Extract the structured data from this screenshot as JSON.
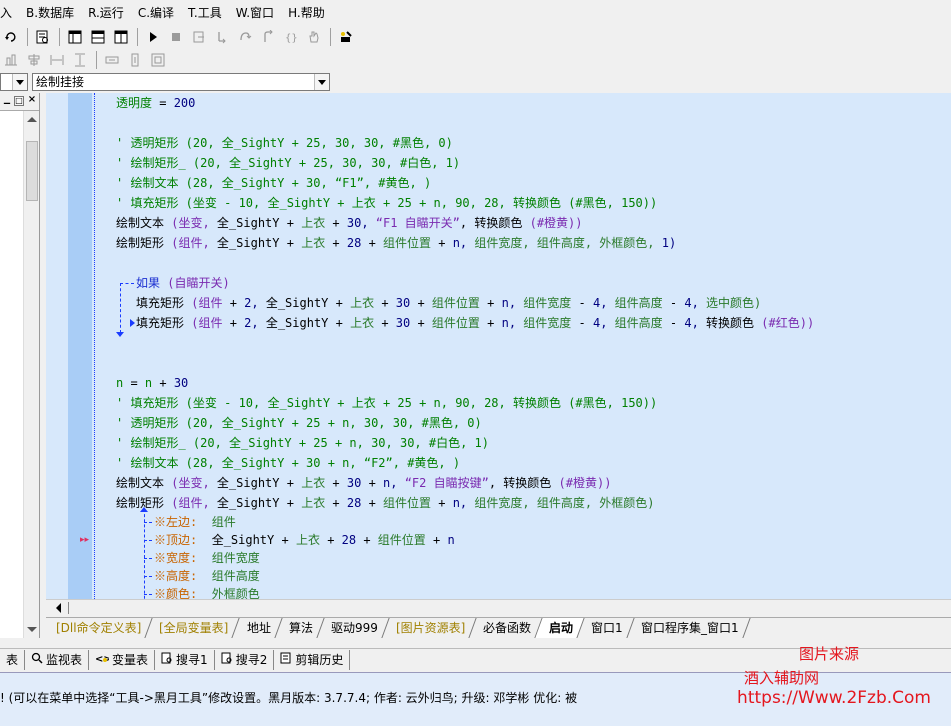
{
  "menu": [
    "入",
    "B.数据库",
    "R.运行",
    "C.编译",
    "T.工具",
    "W.窗口",
    "H.帮助"
  ],
  "combo_left": "",
  "combo_right": "绘制挂接",
  "code_lines": [
    {
      "indent": 0,
      "parts": [
        [
          "c",
          "透明度 "
        ],
        [
          "k",
          "= "
        ],
        [
          "n",
          "200"
        ]
      ]
    },
    {
      "indent": 0,
      "parts": []
    },
    {
      "indent": 0,
      "parts": [
        [
          "c",
          "' 透明矩形 (20, 全_SightY + 25, 30, 30, #黑色, 0)"
        ]
      ]
    },
    {
      "indent": 0,
      "parts": [
        [
          "c",
          "' 绘制矩形_ (20, 全_SightY + 25, 30, 30, #白色, 1)"
        ]
      ]
    },
    {
      "indent": 0,
      "parts": [
        [
          "c",
          "' 绘制文本 (28, 全_SightY + 30, “F1”, #黄色, )"
        ]
      ]
    },
    {
      "indent": 0,
      "parts": [
        [
          "c",
          "' 填充矩形 (坐变 - 10, 全_SightY + 上衣 + 25 + n, 90, 28, 转换颜色 (#黑色, 150))"
        ]
      ]
    },
    {
      "indent": 0,
      "parts": [
        [
          "k",
          "绘制文本 "
        ],
        [
          "p",
          "(坐变, "
        ],
        [
          "k",
          "全_SightY "
        ],
        [
          "k",
          "+ "
        ],
        [
          "s",
          "上衣 "
        ],
        [
          "k",
          "+ "
        ],
        [
          "n",
          "30, "
        ],
        [
          "p",
          "“F1 自瞄开关”"
        ],
        [
          "k",
          ", 转换颜色 "
        ],
        [
          "p",
          "(#橙黄))"
        ]
      ]
    },
    {
      "indent": 0,
      "parts": [
        [
          "k",
          "绘制矩形 "
        ],
        [
          "p",
          "(组件, "
        ],
        [
          "k",
          "全_SightY "
        ],
        [
          "k",
          "+ "
        ],
        [
          "s",
          "上衣 "
        ],
        [
          "k",
          "+ "
        ],
        [
          "n",
          "28 "
        ],
        [
          "k",
          "+ "
        ],
        [
          "s",
          "组件位置 "
        ],
        [
          "k",
          "+ "
        ],
        [
          "n",
          "n, "
        ],
        [
          "s",
          "组件宽度, 组件高度, 外框颜色, "
        ],
        [
          "n",
          "1)"
        ]
      ]
    },
    {
      "indent": 0,
      "parts": []
    },
    {
      "indent": 1,
      "parts": [
        [
          "kw",
          "如果 "
        ],
        [
          "p",
          "(自瞄开关)"
        ]
      ]
    },
    {
      "indent": 1,
      "parts": [
        [
          "k",
          "填充矩形 "
        ],
        [
          "p",
          "(组件 "
        ],
        [
          "k",
          "+ "
        ],
        [
          "n",
          "2, "
        ],
        [
          "k",
          "全_SightY "
        ],
        [
          "k",
          "+ "
        ],
        [
          "s",
          "上衣 "
        ],
        [
          "k",
          "+ "
        ],
        [
          "n",
          "30 "
        ],
        [
          "k",
          "+ "
        ],
        [
          "s",
          "组件位置 "
        ],
        [
          "k",
          "+ "
        ],
        [
          "n",
          "n, "
        ],
        [
          "s",
          "组件宽度 "
        ],
        [
          "k",
          "- "
        ],
        [
          "n",
          "4, "
        ],
        [
          "s",
          "组件高度 "
        ],
        [
          "k",
          "- "
        ],
        [
          "n",
          "4, "
        ],
        [
          "s",
          "选中颜色)"
        ]
      ]
    },
    {
      "indent": 1,
      "parts": [
        [
          "k",
          "填充矩形 "
        ],
        [
          "p",
          "(组件 "
        ],
        [
          "k",
          "+ "
        ],
        [
          "n",
          "2, "
        ],
        [
          "k",
          "全_SightY "
        ],
        [
          "k",
          "+ "
        ],
        [
          "s",
          "上衣 "
        ],
        [
          "k",
          "+ "
        ],
        [
          "n",
          "30 "
        ],
        [
          "k",
          "+ "
        ],
        [
          "s",
          "组件位置 "
        ],
        [
          "k",
          "+ "
        ],
        [
          "n",
          "n, "
        ],
        [
          "s",
          "组件宽度 "
        ],
        [
          "k",
          "- "
        ],
        [
          "n",
          "4, "
        ],
        [
          "s",
          "组件高度 "
        ],
        [
          "k",
          "- "
        ],
        [
          "n",
          "4, "
        ],
        [
          "k",
          "转换颜色 "
        ],
        [
          "p",
          "(#红色))"
        ]
      ]
    },
    {
      "indent": 0,
      "parts": []
    },
    {
      "indent": 0,
      "parts": []
    },
    {
      "indent": 0,
      "parts": [
        [
          "c",
          "n "
        ],
        [
          "k",
          "= "
        ],
        [
          "c",
          "n "
        ],
        [
          "k",
          "+ "
        ],
        [
          "n",
          "30"
        ]
      ]
    },
    {
      "indent": 0,
      "parts": [
        [
          "c",
          "' 填充矩形 (坐变 - 10, 全_SightY + 上衣 + 25 + n, 90, 28, 转换颜色 (#黑色, 150))"
        ]
      ]
    },
    {
      "indent": 0,
      "parts": [
        [
          "c",
          "' 透明矩形 (20, 全_SightY + 25 + n, 30, 30, #黑色, 0)"
        ]
      ]
    },
    {
      "indent": 0,
      "parts": [
        [
          "c",
          "' 绘制矩形_ (20, 全_SightY + 25 + n, 30, 30, #白色, 1)"
        ]
      ]
    },
    {
      "indent": 0,
      "parts": [
        [
          "c",
          "' 绘制文本 (28, 全_SightY + 30 + n, “F2”, #黄色, )"
        ]
      ]
    },
    {
      "indent": 0,
      "parts": [
        [
          "k",
          "绘制文本 "
        ],
        [
          "p",
          "(坐变, "
        ],
        [
          "k",
          "全_SightY "
        ],
        [
          "k",
          "+ "
        ],
        [
          "s",
          "上衣 "
        ],
        [
          "k",
          "+ "
        ],
        [
          "n",
          "30 "
        ],
        [
          "k",
          "+ "
        ],
        [
          "n",
          "n, "
        ],
        [
          "p",
          "“F2 自瞄按键”"
        ],
        [
          "k",
          ", 转换颜色 "
        ],
        [
          "p",
          "(#橙黄))"
        ]
      ]
    },
    {
      "indent": 0,
      "parts": [
        [
          "k",
          "绘制矩形 "
        ],
        [
          "p",
          "(组件, "
        ],
        [
          "k",
          "全_SightY "
        ],
        [
          "k",
          "+ "
        ],
        [
          "s",
          "上衣 "
        ],
        [
          "k",
          "+ "
        ],
        [
          "n",
          "28 "
        ],
        [
          "k",
          "+ "
        ],
        [
          "s",
          "组件位置 "
        ],
        [
          "k",
          "+ "
        ],
        [
          "n",
          "n, "
        ],
        [
          "s",
          "组件宽度, 组件高度, 外框颜色)"
        ]
      ]
    }
  ],
  "params": [
    {
      "label": "※左边:",
      "parts": [
        [
          "s",
          "组件"
        ]
      ]
    },
    {
      "label": "※顶边:",
      "parts": [
        [
          "k",
          "全_SightY "
        ],
        [
          "k",
          "+ "
        ],
        [
          "s",
          "上衣 "
        ],
        [
          "k",
          "+ "
        ],
        [
          "n",
          "28 "
        ],
        [
          "k",
          "+ "
        ],
        [
          "s",
          "组件位置 "
        ],
        [
          "k",
          "+ "
        ],
        [
          "n",
          "n"
        ]
      ]
    },
    {
      "label": "※宽度:",
      "parts": [
        [
          "s",
          "组件宽度"
        ]
      ]
    },
    {
      "label": "※高度:",
      "parts": [
        [
          "s",
          "组件高度"
        ]
      ]
    },
    {
      "label": "※颜色:",
      "parts": [
        [
          "s",
          "外框颜色"
        ]
      ]
    }
  ],
  "tabs": [
    {
      "label": "[Dll命令定义表]",
      "style": "gold"
    },
    {
      "label": "[全局变量表]",
      "style": "gold"
    },
    {
      "label": "地址",
      "style": ""
    },
    {
      "label": "算法",
      "style": ""
    },
    {
      "label": "驱动999",
      "style": ""
    },
    {
      "label": "[图片资源表]",
      "style": "gold"
    },
    {
      "label": "必备函数",
      "style": ""
    },
    {
      "label": "启动",
      "style": "active"
    },
    {
      "label": "窗口1",
      "style": ""
    },
    {
      "label": "窗口程序集_窗口1",
      "style": ""
    }
  ],
  "out_tabs": [
    "表",
    "监视表",
    "变量表",
    "搜寻1",
    "搜寻2",
    "剪辑历史"
  ],
  "status_text": "! (可以在菜单中选择“工具->黑月工具”修改设置。黑月版本: 3.7.7.4; 作者: 云外归鸟; 升级: 邓学彬 优化: 被",
  "watermark": {
    "line1": "图片来源",
    "line2": "酒入辅助网",
    "line3": "https://Www.2Fzb.Com"
  }
}
